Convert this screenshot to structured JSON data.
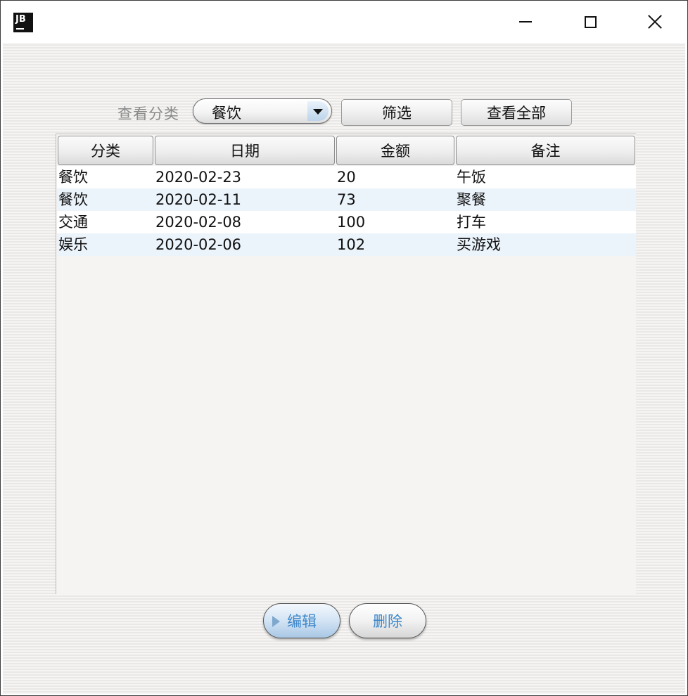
{
  "titlebar": {
    "icon_text": "JB"
  },
  "filter": {
    "label": "查看分类",
    "selected_category": "餐饮",
    "filter_button": "筛选",
    "view_all_button": "查看全部"
  },
  "table": {
    "columns": [
      "分类",
      "日期",
      "金额",
      "备注"
    ],
    "rows": [
      {
        "category": "餐饮",
        "date": "2020-02-23",
        "amount": "20",
        "note": "午饭"
      },
      {
        "category": "餐饮",
        "date": "2020-02-11",
        "amount": "73",
        "note": "聚餐"
      },
      {
        "category": "交通",
        "date": "2020-02-08",
        "amount": "100",
        "note": "打车"
      },
      {
        "category": "娱乐",
        "date": "2020-02-06",
        "amount": "102",
        "note": "买游戏"
      }
    ]
  },
  "actions": {
    "edit": "编辑",
    "delete": "删除"
  },
  "colors": {
    "row_alt": "#ebf3fb",
    "action_text": "#3c86c9"
  }
}
